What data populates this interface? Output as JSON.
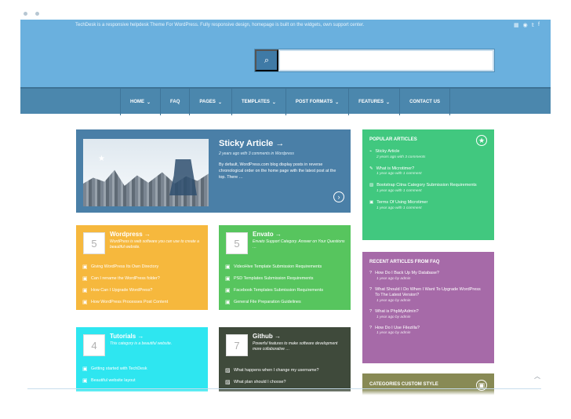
{
  "header": {
    "tagline": "TechDesk is a responsive helpdesk Theme For WordPress. Fully responsive design, homepage is built on the widgets, own support center.",
    "social_icons": [
      "apple-icon",
      "windows-icon",
      "android-icon",
      "twitter-icon",
      "facebook-icon"
    ]
  },
  "search": {
    "placeholder": "",
    "icon": "search-icon"
  },
  "nav": {
    "items": [
      {
        "label": "HOME",
        "dropdown": true
      },
      {
        "label": "FAQ",
        "dropdown": false
      },
      {
        "label": "PAGES",
        "dropdown": true
      },
      {
        "label": "TEMPLATES",
        "dropdown": true
      },
      {
        "label": "POST FORMATS",
        "dropdown": true
      },
      {
        "label": "FEATURES",
        "dropdown": true
      },
      {
        "label": "CONTACT US",
        "dropdown": false
      }
    ]
  },
  "sticky": {
    "title": "Sticky Article →",
    "meta": "2 years ago with 3 comments in Wordpress",
    "text": "By default, WordPress.com blog display posts in reverse chronological order on the home page with the latest post at the top. There …",
    "icon": "star-icon"
  },
  "cards": {
    "wordpress": {
      "number": "5",
      "title": "Wordpress →",
      "desc": "WordPress is web software you can use to create a beautiful website.",
      "links": [
        "Giving WordPress Its Own Directory",
        "Can I rename the WordPress folder?",
        "How Can I Upgrade WordPress?",
        "How WordPress Processes Post Content"
      ]
    },
    "envato": {
      "number": "5",
      "title": "Envato →",
      "desc": "Envato Support Category. Answer on Your Questions …",
      "links": [
        "VideoHive Template Submission Requirements",
        "PSD Templates Submission Requirements",
        "Facebook Templates Submission Requirements",
        "General File Preparation Guidelines"
      ]
    },
    "cyan": {
      "number": "4",
      "title": "Tutorials →",
      "desc": "This category is a beautiful website.",
      "links": [
        "Getting started with TechDesk",
        "Beautiful website layout"
      ]
    },
    "github": {
      "number": "7",
      "title": "Github →",
      "desc": "Powerful features to make software development more collaborative …",
      "links": [
        "What happens when I change my username?",
        "What plan should I choose?"
      ]
    }
  },
  "widgets": {
    "popular": {
      "title": "POPULAR ARTICLES",
      "items": [
        {
          "title": "Sticky Article",
          "meta": "2 years ago with 3 comments"
        },
        {
          "title": "What is Microtimer?",
          "meta": "1 year ago with 1 comment"
        },
        {
          "title": "Bootstrap Citna Category Submission Requirements",
          "meta": "1 year ago with 1 comment"
        },
        {
          "title": "Terms Of Using Microtimer",
          "meta": "1 year ago with 1 comment"
        }
      ]
    },
    "recent_faq": {
      "title": "RECENT ARTICLES FROM FAQ",
      "items": [
        {
          "title": "How Do I Back Up My Database?",
          "meta": "1 year ago by admin"
        },
        {
          "title": "What Should I Do When I Want To Upgrade WordPress To The Latest Version?",
          "meta": "1 year ago by admin"
        },
        {
          "title": "What is PhpMyAdmin?",
          "meta": "1 year ago by admin"
        },
        {
          "title": "How Do I Use Filezilla?",
          "meta": "1 year ago by admin"
        }
      ]
    },
    "categories": {
      "title": "CATEGORIES CUSTOM STYLE"
    }
  },
  "colors": {
    "header": "#6ab0de",
    "nav": "#4b87ad",
    "sticky": "#4a7fa7",
    "wordpress": "#f6b83d",
    "envato": "#57c55e",
    "cyan": "#2ee6f0",
    "github": "#3f4a3b",
    "popular": "#41c87f",
    "faq": "#a66aa8",
    "categories": "#888a55"
  }
}
